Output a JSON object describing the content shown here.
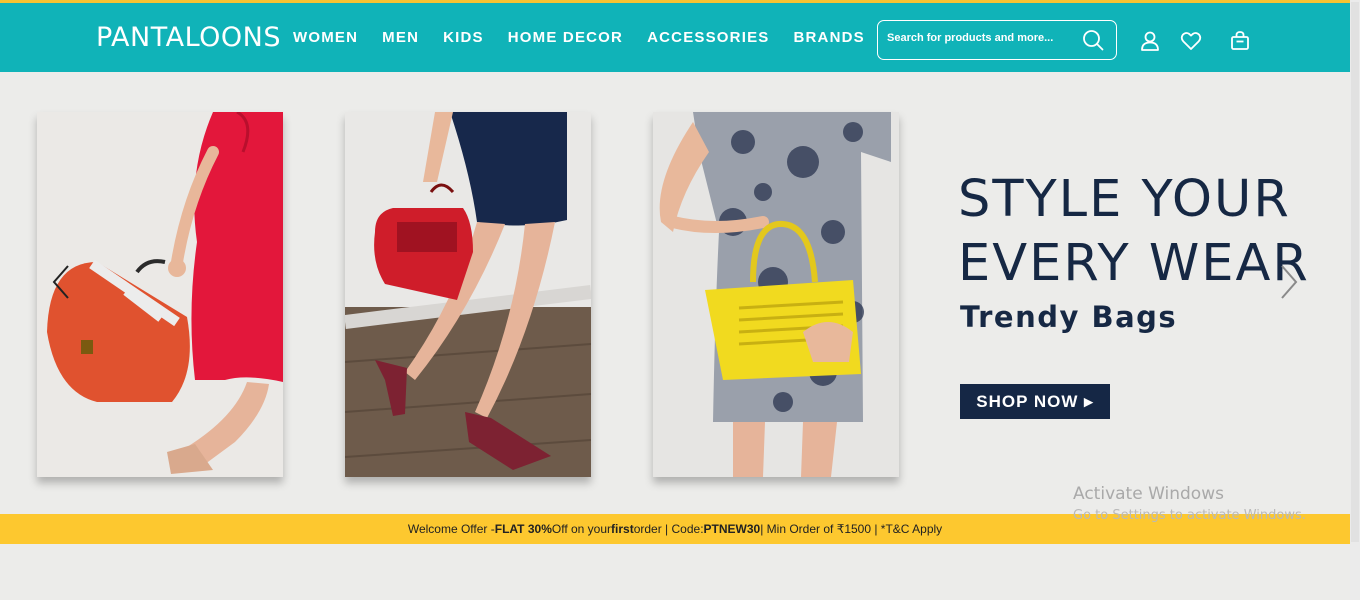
{
  "brand": {
    "logo_text": "PANTALOONS",
    "teal": "#10b3b8",
    "yellow": "#fdc82f",
    "navy": "#152745"
  },
  "nav": {
    "items": [
      {
        "label": "WOMEN"
      },
      {
        "label": "MEN"
      },
      {
        "label": "KIDS"
      },
      {
        "label": "HOME DECOR"
      },
      {
        "label": "ACCESSORIES"
      },
      {
        "label": "BRANDS"
      }
    ]
  },
  "search": {
    "placeholder": "Search for products and more...",
    "value": ""
  },
  "header_icons": [
    "search-icon",
    "user-icon",
    "heart-icon",
    "bag-icon"
  ],
  "hero": {
    "headline_line1": "STYLE YOUR",
    "headline_line2": "EVERY WEAR",
    "subheading": "Trendy Bags",
    "cta_label": "SHOP NOW ▸",
    "photos": [
      "red-dress-orange-handbag",
      "red-snakeskin-handbag-heels",
      "yellow-handbag-floral-dress"
    ]
  },
  "offer": {
    "part1": "Welcome Offer - ",
    "bold1": "FLAT 30%",
    "part2": " Off on your ",
    "bold2": "first",
    "part3": " order | Code: ",
    "bold3": "PTNEW30",
    "part4": " | Min Order of ₹1500 | *T&C Apply"
  },
  "watermark": {
    "line1": "Activate Windows",
    "line2": "Go to Settings to activate Windows."
  }
}
